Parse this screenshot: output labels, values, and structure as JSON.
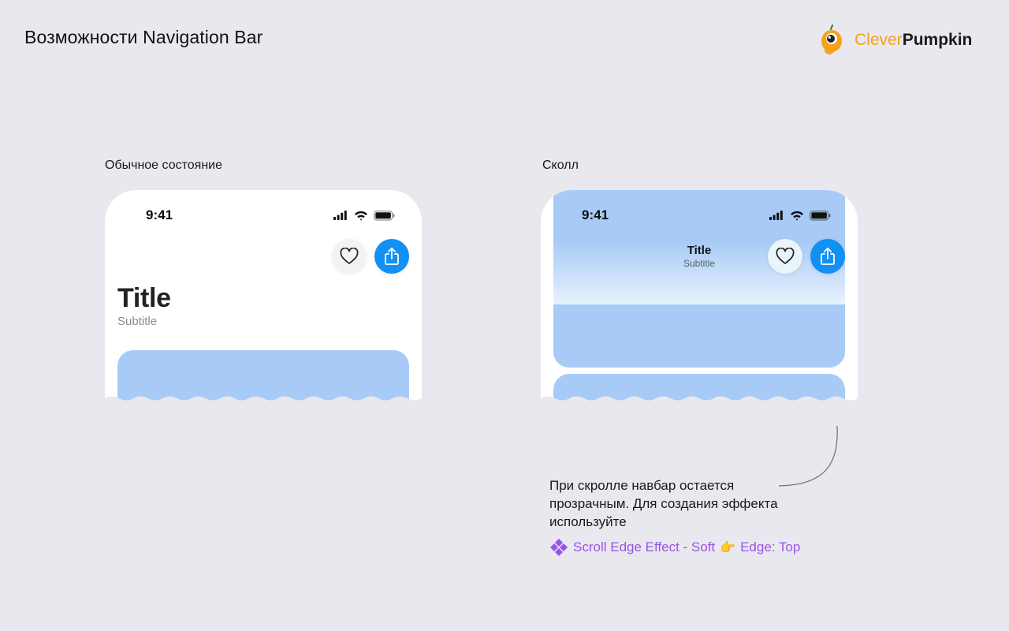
{
  "page": {
    "title": "Возможности Navigation Bar"
  },
  "logo": {
    "word1": "Clever",
    "word2": "Pumpkin",
    "color_primary": "#f4a21a"
  },
  "states": {
    "normal": {
      "caption": "Обычное состояние",
      "time": "9:41",
      "title": "Title",
      "subtitle": "Subtitle"
    },
    "scroll": {
      "caption": "Сколл",
      "time": "9:41",
      "title": "Title",
      "subtitle": "Subtitle"
    }
  },
  "icons": {
    "favorite": "heart-icon",
    "share": "share-icon",
    "signal": "cellular-signal-icon",
    "wifi": "wifi-icon",
    "battery": "battery-icon",
    "component": "component-icon",
    "hand": "pointing-hand-icon"
  },
  "colors": {
    "accent": "#1191f4",
    "card": "#a7cbf6",
    "component": "#9b53e8"
  },
  "note": {
    "text": "При скролле навбар остается прозрачным. Для создания эффекта используйте",
    "component_name": "Scroll Edge Effect - Soft",
    "hand": "👉",
    "component_option": "Edge: Top"
  }
}
